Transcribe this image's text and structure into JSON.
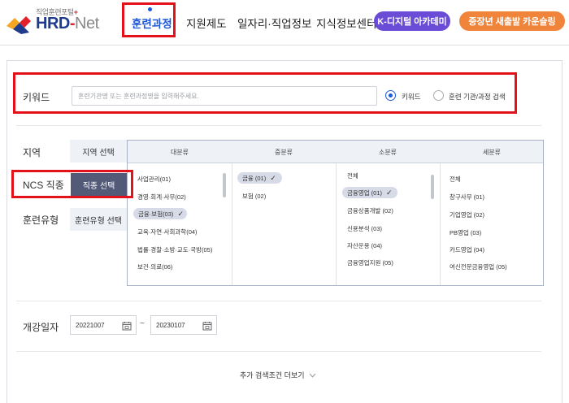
{
  "header": {
    "logo_sub": "직업훈련포털",
    "logo_name": "HRD",
    "logo_dash": "-",
    "logo_net": "Net",
    "nav": [
      {
        "label": "훈련과정",
        "active": true
      },
      {
        "label": "지원제도"
      },
      {
        "label": "일자리·직업정보"
      },
      {
        "label": "지식정보센터"
      }
    ],
    "pill_digital": "K-디지털 아카데미",
    "pill_counsel": "중장년 새출발 카운슬링",
    "colors": {
      "brand_blue": "#1d57d6",
      "purple": "#6a4cd6",
      "orange": "#f0843a",
      "highlight_red": "#e4101a"
    }
  },
  "search": {
    "keyword_label": "키워드",
    "keyword_placeholder": "훈련기관명 또는 훈련과정명을 입력해주세요.",
    "radio_keyword": "키워드",
    "radio_institution": "훈련 기관/과정 검색",
    "region_label": "지역",
    "region_button": "지역 선택",
    "ncs_label": "NCS 직종",
    "ncs_button": "직종 선택",
    "type_label": "훈련유형",
    "type_button": "훈련유형 선택",
    "date_label": "개강일자",
    "date_start": "20221007",
    "date_tilde": "~",
    "date_end": "20230107",
    "more_label": "추가 검색조건 더보기"
  },
  "categories": {
    "headers": [
      "대분류",
      "중분류",
      "소분류",
      "세분류"
    ],
    "major": [
      "사업관리(01)",
      "경영·회계·사무(02)",
      "금융·보험(03)",
      "교육·자연·사회과학(04)",
      "법률·경찰·소방·교도·국방(05)",
      "보건·의료(06)"
    ],
    "middle": [
      "금융 (01)",
      "보험 (02)"
    ],
    "minor": [
      "전체",
      "금융영업 (01)",
      "금융상품개발 (02)",
      "신용분석 (03)",
      "자산운용 (04)",
      "금융영업지원 (05)"
    ],
    "detail": [
      "전체",
      "창구사무 (01)",
      "기업영업 (02)",
      "PB영업 (03)",
      "카드영업 (04)",
      "여신전문금융영업 (05)"
    ]
  }
}
